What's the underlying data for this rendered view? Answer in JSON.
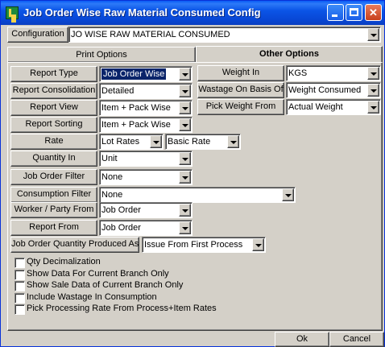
{
  "window": {
    "title": "Job Order Wise Raw Material Consumed Config"
  },
  "configuration": {
    "label": "Configuration",
    "value": "JO WISE RAW MATERIAL CONSUMED"
  },
  "tabs": [
    {
      "label": "Print Options"
    },
    {
      "label": "Other Options"
    }
  ],
  "print_options": {
    "report_type": {
      "label": "Report Type",
      "value": "Job Order Wise"
    },
    "report_consolidation": {
      "label": "Report Consolidation",
      "value": "Detailed"
    },
    "report_view": {
      "label": "Report View",
      "value": "Item + Pack Wise"
    },
    "report_sorting": {
      "label": "Report Sorting",
      "value": "Item + Pack Wise"
    },
    "rate": {
      "label": "Rate",
      "value": "Lot Rates",
      "value2": "Basic Rate"
    },
    "quantity_in": {
      "label": "Quantity In",
      "value": "Unit"
    },
    "job_order_filter": {
      "label": "Job Order Filter",
      "value": "None"
    },
    "consumption_filter": {
      "label": "Consumption Filter",
      "value": "None"
    },
    "worker_party_from": {
      "label": "Worker / Party From",
      "value": "Job Order"
    },
    "report_from": {
      "label": "Report From",
      "value": "Job Order"
    },
    "job_order_qty_produced_as": {
      "label": "Job Order Quantity Produced As",
      "value": "Issue From First Process"
    }
  },
  "other_options": {
    "weight_in": {
      "label": "Weight In",
      "value": "KGS"
    },
    "wastage_on_basis_of": {
      "label": "Wastage On Basis Of",
      "value": "Weight Consumed"
    },
    "pick_weight_from": {
      "label": "Pick Weight From",
      "value": "Actual Weight"
    }
  },
  "checkboxes": [
    {
      "label": "Qty Decimalization",
      "checked": false
    },
    {
      "label": "Show Data For Current Branch Only",
      "checked": false
    },
    {
      "label": "Show Sale Data of Current Branch Only",
      "checked": false
    },
    {
      "label": "Include Wastage  In Consumption",
      "checked": false
    },
    {
      "label": "Pick Processing Rate From Process+Item Rates",
      "checked": false
    }
  ],
  "buttons": {
    "ok": "Ok",
    "cancel": "Cancel"
  }
}
